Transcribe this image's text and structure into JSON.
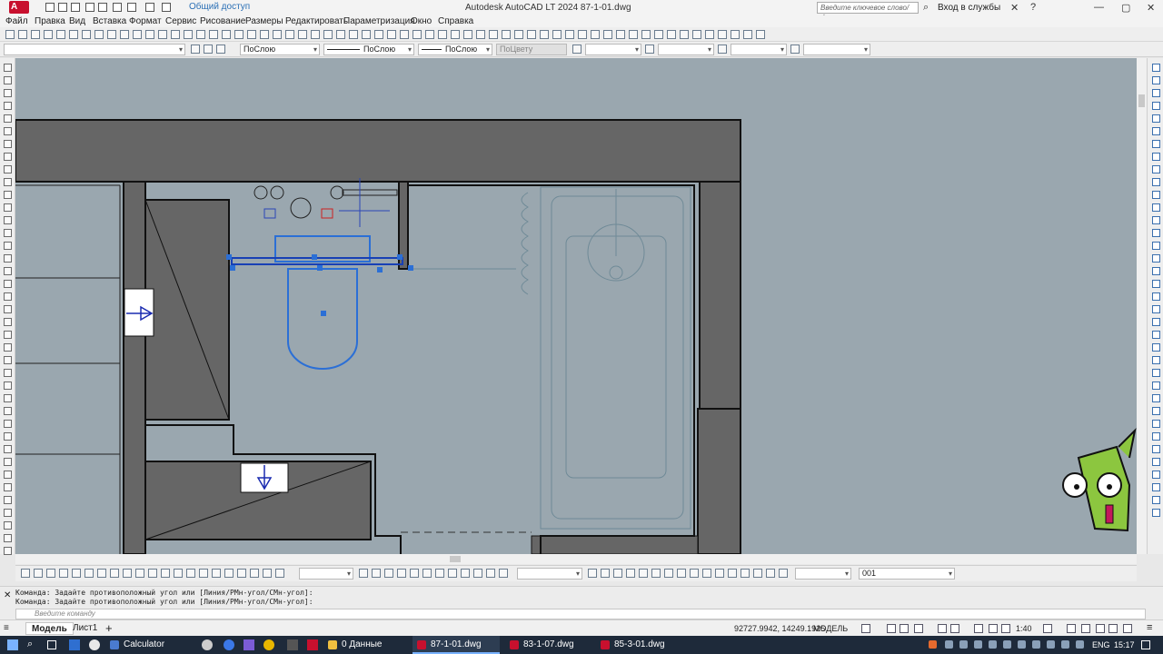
{
  "titlebar": {
    "logo": "A LT",
    "share": "Общий доступ",
    "title": "Autodesk AutoCAD LT 2024    87-1-01.dwg",
    "search_placeholder": "Введите ключевое слово/фразу",
    "login": "Вход в службы"
  },
  "menu": [
    "Файл",
    "Правка",
    "Вид",
    "Вставка",
    "Формат",
    "Сервис",
    "Рисование",
    "Размеры",
    "Редактировать",
    "Параметризация",
    "Окно",
    "Справка"
  ],
  "properties": {
    "layer": "ПоСлою",
    "linetype": "ПоСлою",
    "lineweight": "ПоСлою",
    "color": "ПоЦвету"
  },
  "dimstyle": {
    "style_value": "001"
  },
  "command": {
    "line1": "Команда: Задайте противоположный угол или [Линия/РМн-угол/СМн-угол]:",
    "line2": "Команда: Задайте противоположный угол или [Линия/РМн-угол/СМн-угол]:",
    "placeholder": "Введите команду"
  },
  "status": {
    "tab_model": "Модель",
    "tab_sheet": "Лист1",
    "coords": "92727.9942, 14249.1925",
    "mode": "МОДЕЛЬ",
    "scale": "1:40"
  },
  "taskbar": {
    "calculator": "Calculator",
    "folder": "0 Данные",
    "file1": "87-1-01.dwg",
    "file2": "83-1-07.dwg",
    "file3": "85-3-01.dwg",
    "lang": "ENG",
    "time": "15:17"
  },
  "colors": {
    "canvas": "#9aa7af",
    "wall": "#666666",
    "selection": "#2b6fd6",
    "accent": "#c8102e"
  }
}
